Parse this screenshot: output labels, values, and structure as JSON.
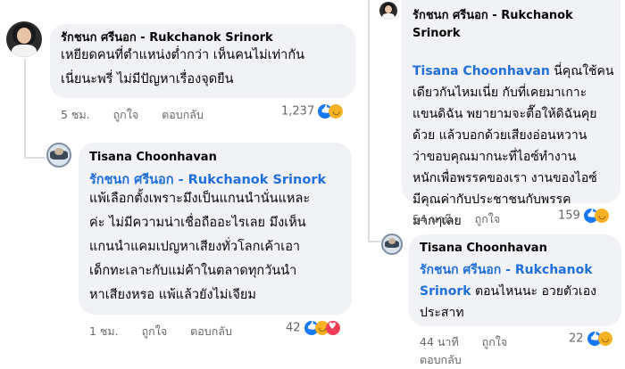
{
  "left": {
    "comment1": {
      "author": "รักชนก ศรีนอก - Rukchanok Srinork",
      "text": "เหยียดคนที่ตำแหน่งต่ำกว่า เห็นคนไม่เท่ากัน\nเนี่ยนะพรี่ ไม่มีปัญหาเรื่องจุดยืน",
      "time": "5 ชม.",
      "like": "ถูกใจ",
      "reply": "ตอบกลับ",
      "reactions": "1,237"
    },
    "comment2": {
      "author": "Tisana Choonhavan",
      "mention": "รักชนก ศรีนอก - Rukchanok Srinork",
      "text": "แพ้เลือกตั้งเพราะมึงเป็นแกนนำนั่นแหละ\nค่ะ ไม่มีความน่าเชื่อถืออะไรเลย มึงเห็น\nแกนนำแคมเปญหาเสียงทั่วโลกเค้าเอา\nเด็กทะเลาะกับแม่ค้าในตลาดทุกวันนำ\nหาเสียงหรอ แพ้แล้วยังไม่เจียม",
      "time": "1 ชม.",
      "like": "ถูกใจ",
      "reply": "ตอบกลับ",
      "reactions": "42"
    }
  },
  "right": {
    "comment1": {
      "author_line1": "รักชนก ศรีนอก - Rukchanok",
      "author_line2": "Srinork",
      "mention": "Tisana Choonhavan",
      "text_first": " นี่คุณใช้คน",
      "text": "เดียวกันไหมเนี่ย กับที่เคยมาเกาะ\nแขนดิฉัน พยายามจะตื๊อให้ดิฉันคุย\nด้วย แล้วบอกด้วยเสียงอ่อนหวาน\nว่าขอบคุณมากนะที่ไอซ์ทำงาน\nหนักเพื่อพรรคของเรา งานของไอซ์\nมีคุณค่ากับประชาชนกับพรรค\nมากๆเลย",
      "time": "54 นาที",
      "like": "ถูกใจ",
      "reactions": "159"
    },
    "comment2": {
      "author": "Tisana Choonhavan",
      "mention_line1": "รักชนก ศรีนอก - Rukchanok",
      "mention_line2": "Srinork",
      "text_tail": " ตอนไหนนะ อวยตัวเอง",
      "text_line2": "ประสาท",
      "time": "44 นาที",
      "like": "ถูกใจ",
      "reply": "ตอบกลับ",
      "reactions": "22"
    }
  },
  "colors": {
    "bubble": "#f0f2f5",
    "mention": "#216fdb",
    "meta": "#65676b"
  }
}
